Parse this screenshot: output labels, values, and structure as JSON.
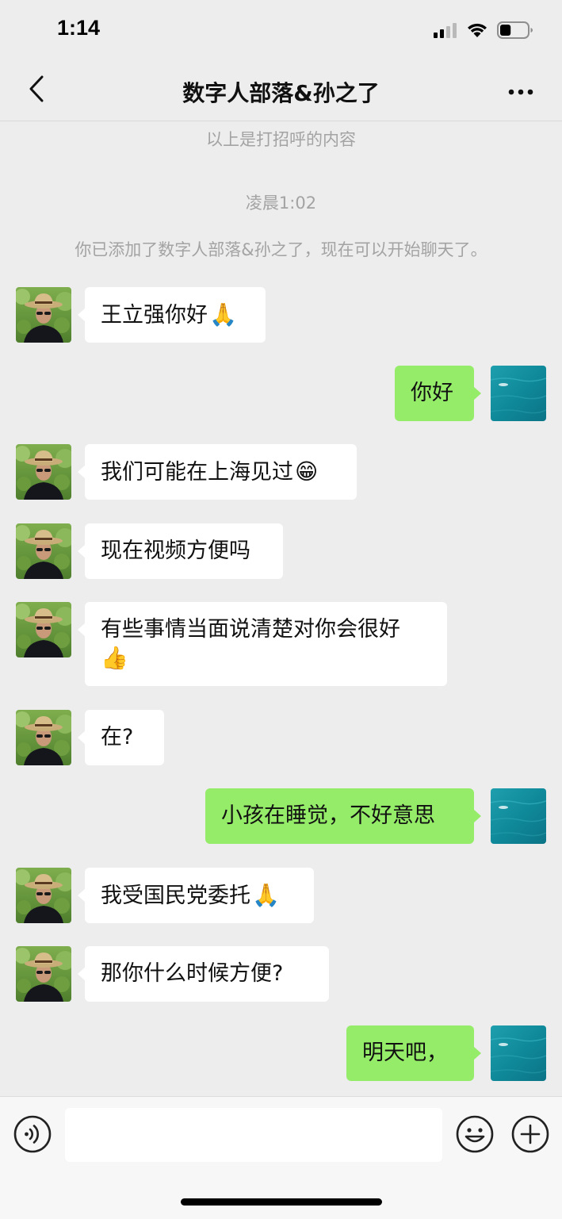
{
  "status_bar": {
    "time": "1:14",
    "battery_level": 0.4
  },
  "nav": {
    "title": "数字人部落&孙之了",
    "back_icon": "chevron-left-icon",
    "more_icon": "ellipsis-icon"
  },
  "system": {
    "greeting_note": "以上是打招呼的内容",
    "timestamp": "凌晨1:02",
    "added_note": "你已添加了数字人部落&孙之了，现在可以开始聊天了。"
  },
  "messages": [
    {
      "side": "in",
      "text": "王立强你好",
      "emoji": "🙏"
    },
    {
      "side": "out",
      "text": "你好"
    },
    {
      "side": "in",
      "text": "我们可能在上海见过",
      "emoji": "😁"
    },
    {
      "side": "in",
      "text": "现在视频方便吗"
    },
    {
      "side": "in",
      "text": "有些事情当面说清楚对你会很好",
      "emoji": "👍"
    },
    {
      "side": "in",
      "text": "在?"
    },
    {
      "side": "out",
      "text": "小孩在睡觉，不好意思"
    },
    {
      "side": "in",
      "text": "我受国民党委托",
      "emoji": "🙏"
    },
    {
      "side": "in",
      "text": "那你什么时候方便?"
    },
    {
      "side": "out",
      "text": "明天吧，"
    }
  ],
  "input_bar": {
    "voice_icon": "voice-icon",
    "emoji_icon": "emoji-icon",
    "plus_icon": "plus-icon",
    "input_value": ""
  },
  "colors": {
    "background": "#ededed",
    "incoming_bubble": "#ffffff",
    "outgoing_bubble": "#95ec69",
    "system_text": "#a3a3a3"
  }
}
